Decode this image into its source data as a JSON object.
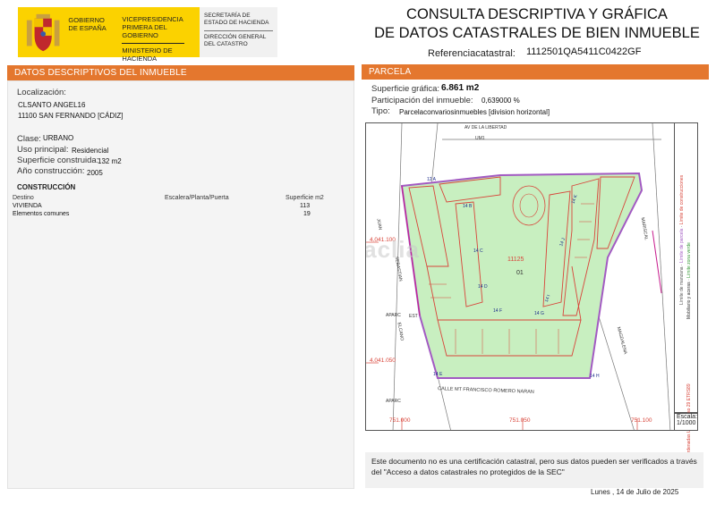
{
  "header": {
    "gov_text": "GOBIERNO DE ESPAÑA",
    "vice_line1": "VICEPRESIDENCIA",
    "vice_line2": "PRIMERA DEL GOBIERNO",
    "ministry": "MINISTERIO DE HACIENDA",
    "secretaria": "SECRETARÍA DE ESTADO DE HACIENDA",
    "direccion": "DIRECCIÓN GENERAL DEL CATASTRO",
    "title_line1": "CONSULTA DESCRIPTIVA Y GRÁFICA",
    "title_line2": "DE DATOS CATASTRALES DE BIEN INMUEBLE",
    "ref_label": "Referenciacatastral:",
    "ref_value": "1112501QA5411C0422GF"
  },
  "left": {
    "section_title": "DATOS DESCRIPTIVOS DEL INMUEBLE",
    "localizacion_label": "Localización:",
    "address_line1": "CLSANTO ANGEL16",
    "address_line2": "11100 SAN FERNANDO [CÁDIZ]",
    "clase_label": "Clase:",
    "clase_value": "URBANO",
    "uso_label": "Uso principal:",
    "uso_value": "Residencial",
    "superficie_label": "Superficie construida:",
    "superficie_value": "132 m2",
    "anio_label": "Año construcción:",
    "anio_value": "2005",
    "construccion_title": "CONSTRUCCIÓN",
    "table_headers": [
      "Destino",
      "Escalera/Planta/Puerta",
      "Superficie m2"
    ],
    "table_rows": [
      {
        "destino": "VIVIENDA",
        "esc": "",
        "sup": "113"
      },
      {
        "destino": "Elementos comunes",
        "esc": "",
        "sup": "19"
      }
    ]
  },
  "right": {
    "section_title": "PARCELA",
    "sup_grafica_label": "Superficie gráfica:",
    "sup_grafica_value": "6.861 m2",
    "participacion_label": "Participación del inmueble:",
    "participacion_value": "0,639000 %",
    "tipo_label": "Tipo:",
    "tipo_value": "Parcelaconvariosinmuebles [division horizontal]"
  },
  "map": {
    "street_top": "AV DE LA LIBERTAD",
    "street_top2": "UM1",
    "street_bottom": "CALLE MT FRANCISCO ROMERO NARAN",
    "street_left1": "JUAN",
    "street_left2": "SEBASTIAN",
    "street_left3": "ELCANO",
    "street_right1": "MARISCAL",
    "street_right2": "MAGDALENA",
    "aparc1": "APARC",
    "aparc2": "EST",
    "aparc3": "APARC",
    "parcel_number": "11125",
    "parcel_sub": "01",
    "coord_y1": "4.041.100",
    "coord_y2": "4.041.050",
    "coord_x1": "751.000",
    "coord_x2": "751.050",
    "coord_x3": "751.100",
    "blocks": [
      "12 A",
      "14 B",
      "14 K",
      "14 J",
      "14 I",
      "14 C",
      "14 F",
      "14 G",
      "14 D",
      "14 E",
      "14 H"
    ],
    "scale_label": "Escala:",
    "scale_value": "1/1000",
    "legend_1": "Límite de manzana",
    "legend_2": "Límite de parcela",
    "legend_3": "Límite de construcciones",
    "legend_4": "Mobiliario y aceras",
    "legend_5": "Límite zona verde",
    "legend_coords": "751.100 Coordenadas U.T.M. Huso 29 ETRS89",
    "watermark": "habitaclia"
  },
  "footer": {
    "notice": "Este documento no es una certificación catastral, pero sus datos pueden ser verificados a través del \"Acceso a datos catastrales no protegidos de la SEC\"",
    "date": "Lunes , 14 de Julio de 2025"
  },
  "colors": {
    "accent": "#e4772e",
    "gov_yellow": "#fbd200",
    "parcel_green": "#c8efc0",
    "parcel_border": "#a25ac2",
    "building_line": "#d8453a"
  }
}
